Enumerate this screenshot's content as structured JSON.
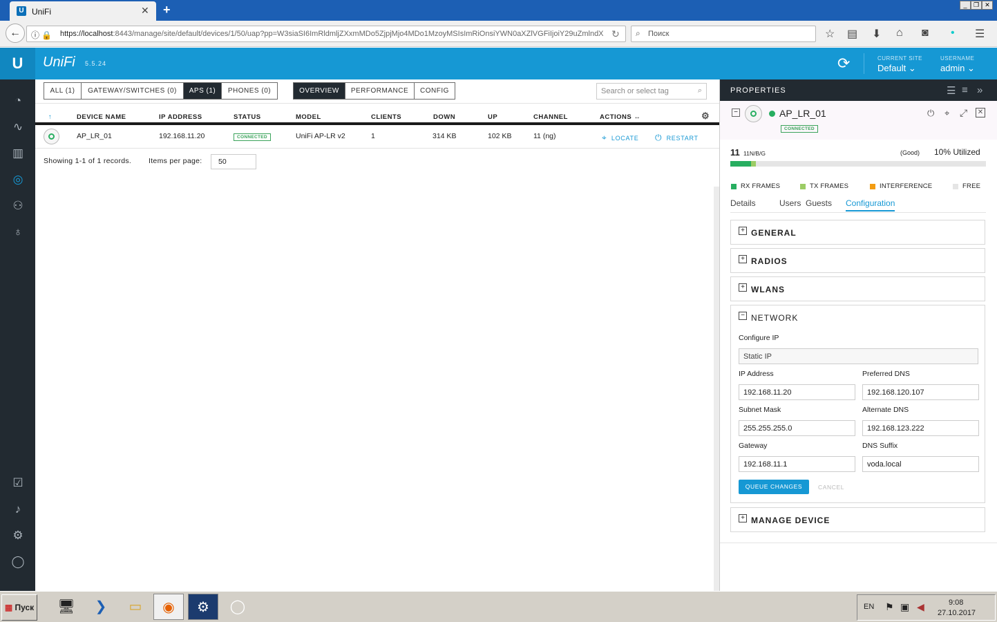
{
  "browser": {
    "tab_title": "UniFi",
    "url_host": "https://localhost",
    "url_rest": ":8443/manage/site/default/devices/1/50/uap?pp=W3siaSI6ImRldmljZXxmMDo5ZjpjMjo4MDo1MzoyMSIsImRiOnsiYWN0aXZlVGFiIjoiY29uZmlndX",
    "search_placeholder": "Поиск"
  },
  "header": {
    "brand": "UniFi",
    "version": "5.5.24",
    "current_site_label": "CURRENT SITE",
    "current_site_value": "Default",
    "username_label": "USERNAME",
    "username_value": "admin"
  },
  "filters": {
    "all": "ALL (1)",
    "gateways": "GATEWAY/SWITCHES (0)",
    "aps": "APS (1)",
    "phones": "PHONES (0)",
    "overview": "OVERVIEW",
    "performance": "PERFORMANCE",
    "config": "CONFIG",
    "search_placeholder": "Search or select tag"
  },
  "table": {
    "headers": [
      "DEVICE NAME",
      "IP ADDRESS",
      "STATUS",
      "MODEL",
      "CLIENTS",
      "DOWN",
      "UP",
      "CHANNEL",
      "ACTIONS"
    ],
    "row": {
      "name": "AP_LR_01",
      "ip": "192.168.11.20",
      "status": "CONNECTED",
      "model": "UniFi AP-LR v2",
      "clients": "1",
      "down": "314 KB",
      "up": "102 KB",
      "channel": "11 (ng)",
      "locate": "LOCATE",
      "restart": "RESTART"
    },
    "showing": "Showing 1-1 of 1 records.",
    "items_per_page_label": "Items per page:",
    "items_per_page": "50"
  },
  "properties": {
    "title": "PROPERTIES",
    "device_name": "AP_LR_01",
    "status": "CONNECTED",
    "channel_num": "11",
    "channel_mode": "11N/B/G",
    "quality": "(Good)",
    "utilized": "10% Utilized",
    "util_rx": 0.08,
    "util_tx": 0.02,
    "legend": {
      "rx": "RX FRAMES",
      "tx": "TX FRAMES",
      "interference": "INTERFERENCE",
      "free": "FREE"
    },
    "tabs": [
      "Details",
      "Users",
      "Guests",
      "Configuration"
    ],
    "sections": {
      "general": "GENERAL",
      "radios": "RADIOS",
      "wlans": "WLANS",
      "network": "NETWORK",
      "manage": "MANAGE DEVICE"
    },
    "network": {
      "configure_ip_label": "Configure IP",
      "configure_ip": "Static IP",
      "ip_label": "IP Address",
      "ip": "192.168.11.20",
      "pdns_label": "Preferred DNS",
      "pdns": "192.168.120.107",
      "mask_label": "Subnet Mask",
      "mask": "255.255.255.0",
      "adns_label": "Alternate DNS",
      "adns": "192.168.123.222",
      "gw_label": "Gateway",
      "gw": "192.168.11.1",
      "suffix_label": "DNS Suffix",
      "suffix": "voda.local",
      "queue": "QUEUE CHANGES",
      "cancel": "CANCEL"
    }
  },
  "colors": {
    "accent": "#1698d4",
    "rx": "#27ae60",
    "tx": "#9ccc65",
    "interference": "#f39c12",
    "free": "#e5e5e5"
  },
  "taskbar": {
    "start": "Пуск",
    "lang": "EN",
    "time": "9:08",
    "date": "27.10.2017"
  }
}
